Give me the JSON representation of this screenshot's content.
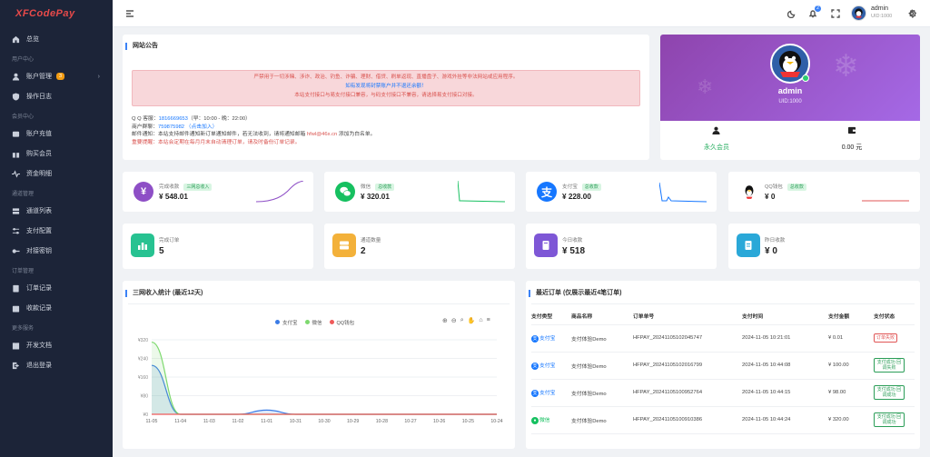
{
  "brand": "XFCodePay",
  "nav": {
    "home": "总览",
    "sec_user": "用户中心",
    "account": "账户管理",
    "account_badge": "3",
    "log": "操作日志",
    "sec_member": "会员中心",
    "recharge": "账户充值",
    "buy_vip": "购买会员",
    "funds": "资金明细",
    "sec_channel": "通道管理",
    "channel_list": "通道列表",
    "pay_config": "支付配置",
    "keys": "对接密钥",
    "sec_order": "订单管理",
    "orders": "订单记录",
    "receipts": "收款记录",
    "sec_more": "更多服务",
    "docs": "开发文档",
    "logout": "退出登录"
  },
  "topbar": {
    "notif_count": "2",
    "username": "admin",
    "uid": "UID:1000"
  },
  "notice": {
    "title": "网站公告",
    "line1": "严禁用于一切涉赌、涉诈、政治、钓鱼、诈骗、理财、借贷、刷单返现、直播盘子、游戏外挂等非法网站或应用程序。",
    "line2": "如有发现将封禁账户并不退还余额！",
    "line3": "本站支付接口与易支付接口兼容，与码支付接口不兼容，请选择易支付接口对接。",
    "qq_label": "Q Q 客服：",
    "qq_value": "1816669653",
    "qq_hours": "（早：10:00 - 晚：22:00）",
    "group_label": "商户群聊：",
    "group_value": "759875982",
    "group_action": "（点击加入）",
    "mail_label": "邮件通知：",
    "mail_text": "本站支持邮件通知新订单通知邮件，若无法收到，请将通知邮箱",
    "mail_addr": "hfwl@46x.cn",
    "mail_tail": "添加为白名单。",
    "remind_label": "重要提醒：",
    "remind_text": "本站会定期在每月月末自动清理订单，请及时备份订单记录。"
  },
  "profile": {
    "name": "admin",
    "uid": "UID:1000",
    "vip_label": "永久会员",
    "balance": "0.00 元",
    "bg_color": "#9b59d4"
  },
  "stats": [
    {
      "label": "完成收款",
      "tag": "三网总收入",
      "value": "¥ 548.01",
      "color": "#8e4fc6"
    },
    {
      "label": "微信",
      "tag": "总收款",
      "value": "¥ 320.01",
      "color": "#16c060"
    },
    {
      "label": "支付宝",
      "tag": "总收款",
      "value": "¥ 228.00",
      "color": "#1677ff"
    },
    {
      "label": "QQ钱包",
      "tag": "总收款",
      "value": "¥ 0",
      "color": "#222"
    }
  ],
  "stats2": [
    {
      "label": "完成订单",
      "value": "5",
      "color": "#27c291"
    },
    {
      "label": "通道数量",
      "value": "2",
      "color": "#f3b13a"
    },
    {
      "label": "今日收款",
      "value": "¥ 518",
      "color": "#7e57d6"
    },
    {
      "label": "昨日收款",
      "value": "¥ 0",
      "color": "#2aa8d8"
    }
  ],
  "chart_panel_title": "三网收入统计 (最近12天)",
  "chart_data": {
    "type": "area",
    "x": [
      "11-05",
      "11-04",
      "11-03",
      "11-02",
      "11-01",
      "10-31",
      "10-30",
      "10-29",
      "10-28",
      "10-27",
      "10-26",
      "10-25",
      "10-24"
    ],
    "yticks": [
      "¥0",
      "¥80",
      "¥160",
      "¥240",
      "¥320"
    ],
    "ylim": [
      0,
      320
    ],
    "legend_position": "top",
    "series": [
      {
        "name": "支付宝",
        "color": "#3b7ce6",
        "values": [
          210,
          0,
          0,
          0,
          18,
          0,
          0,
          0,
          0,
          0,
          0,
          0,
          0
        ]
      },
      {
        "name": "微信",
        "color": "#7ed96f",
        "values": [
          310,
          0,
          0,
          0,
          0,
          0,
          0,
          0,
          0,
          0,
          0,
          0,
          0
        ]
      },
      {
        "name": "QQ钱包",
        "color": "#ef5a5a",
        "values": [
          0,
          0,
          0,
          0,
          0,
          0,
          0,
          0,
          0,
          0,
          0,
          0,
          0
        ]
      }
    ]
  },
  "orders": {
    "title": "最近订单 (仅展示最近4笔订单)",
    "headers": [
      "支付类型",
      "商品名称",
      "订单单号",
      "支付时间",
      "支付金额",
      "支付状态"
    ],
    "rows": [
      {
        "type": "支付宝",
        "type_color": "#1677ff",
        "name": "支付体验Demo",
        "no": "HFPAY_20241105102045747",
        "time": "2024-11-05 10:21:01",
        "amount": "¥ 0.01",
        "status": "订单失败",
        "ok": false
      },
      {
        "type": "支付宝",
        "type_color": "#1677ff",
        "name": "支付体验Demo",
        "no": "HFPAY_20241105102016799",
        "time": "2024-11-05 10:44:08",
        "amount": "¥ 100.00",
        "status": "支付成功 回调失败",
        "ok": true
      },
      {
        "type": "支付宝",
        "type_color": "#1677ff",
        "name": "支付体验Demo",
        "no": "HFPAY_20241105100952764",
        "time": "2024-11-05 10:44:15",
        "amount": "¥ 98.00",
        "status": "支付成功 回调成功",
        "ok": true
      },
      {
        "type": "微信",
        "type_color": "#16c060",
        "name": "支付体验Demo",
        "no": "HFPAY_20241105100910386",
        "time": "2024-11-05 10:44:24",
        "amount": "¥ 320.00",
        "status": "支付成功 回调成功",
        "ok": true
      }
    ]
  }
}
